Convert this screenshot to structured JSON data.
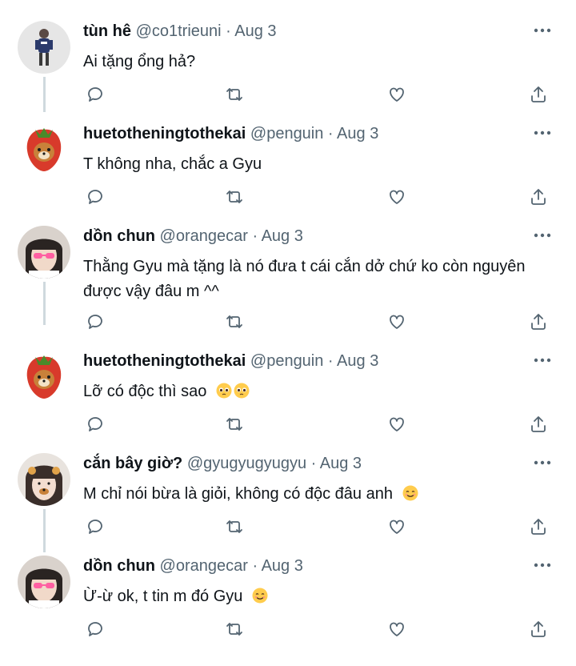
{
  "tweets": [
    {
      "name": "tùn hê",
      "handle": "@co1trieuni",
      "date": "Aug 3",
      "text": "Ai tặng ổng hả?",
      "emojis": []
    },
    {
      "name": "huetotheningtothekai",
      "handle": "@penguin",
      "date": "Aug 3",
      "text": "T không nha, chắc a Gyu",
      "emojis": []
    },
    {
      "name": "dồn chun",
      "handle": "@orangecar",
      "date": "Aug 3",
      "text": "Thằng Gyu mà tặng là nó đưa t cái cắn dở chứ ko còn nguyên được vậy đâu m ^^",
      "emojis": []
    },
    {
      "name": "huetotheningtothekai",
      "handle": "@penguin",
      "date": "Aug 3",
      "text": "Lỡ có độc thì sao",
      "emojis": [
        "pleading-face-emoji",
        "pleading-face-emoji"
      ]
    },
    {
      "name": "cắn bây giờ?",
      "handle": "@gyugyugyugyu",
      "date": "Aug 3",
      "text": "M chỉ nói bừa là giỏi, không có độc đâu anh",
      "emojis": [
        "smiling-face-emoji"
      ]
    },
    {
      "name": "dồn chun",
      "handle": "@orangecar",
      "date": "Aug 3",
      "text": "Ừ-ừ ok, t tin m đó Gyu",
      "emojis": [
        "smiling-face-emoji"
      ]
    }
  ],
  "separator": " · ",
  "icons": {
    "more": "more-dots-icon",
    "reply": "reply-icon",
    "retweet": "retweet-icon",
    "like": "like-icon",
    "share": "share-icon"
  },
  "colors": {
    "text": "#0f1419",
    "secondary": "#536471",
    "thread_line": "#cfd9de",
    "background": "#ffffff"
  }
}
